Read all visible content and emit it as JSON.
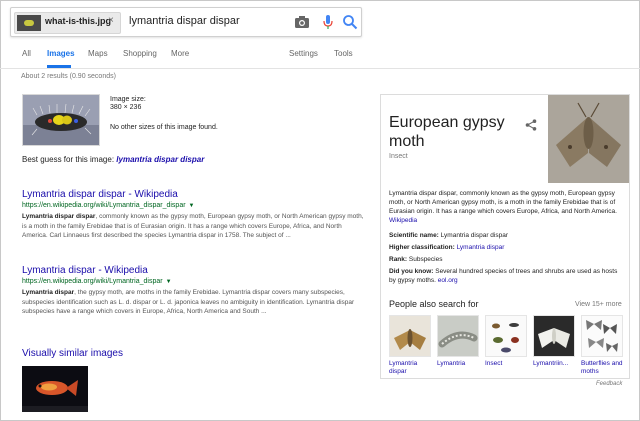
{
  "search": {
    "chip_label": "what-is-this.jpg",
    "chip_close": "×",
    "query": "lymantria dispar dispar"
  },
  "tabs": [
    {
      "label": "All"
    },
    {
      "label": "Images"
    },
    {
      "label": "Maps"
    },
    {
      "label": "Shopping"
    },
    {
      "label": "More"
    },
    {
      "label": "Settings"
    },
    {
      "label": "Tools"
    }
  ],
  "result_stats": "About 2 results (0.90 seconds)",
  "image_info": {
    "size_label": "Image size:",
    "size_value": "380 × 236",
    "no_other": "No other sizes of this image found."
  },
  "best_guess": {
    "prefix": "Best guess for this image:",
    "value": "lymantria dispar dispar"
  },
  "results": [
    {
      "title": "Lymantria dispar dispar - Wikipedia",
      "url": "https://en.wikipedia.org/wiki/Lymantria_dispar_dispar",
      "snippet_bold": "Lymantria dispar dispar",
      "snippet_rest": ", commonly known as the gypsy moth, European gypsy moth, or North American gypsy moth, is a moth in the family Erebidae that is of Eurasian origin. It has a range which covers Europe, Africa, and North America. Carl Linnaeus first described the species Lymantria dispar in 1758. The subject of ..."
    },
    {
      "title": "Lymantria dispar - Wikipedia",
      "url": "https://en.wikipedia.org/wiki/Lymantria_dispar",
      "snippet_bold": "Lymantria dispar",
      "snippet_rest": ", the gypsy moth, are moths in the family Erebidae. Lymantria dispar covers many subspecies, subspecies identification such as L. d. dispar or L. d. japonica leaves no ambiguity in identification. Lymantria dispar subspecies have a range which covers in Europe, Africa, North America and South ..."
    }
  ],
  "similar_title": "Visually similar images",
  "knowledge_panel": {
    "title": "European gypsy moth",
    "subtitle": "Insect",
    "description": "Lymantria dispar dispar, commonly known as the gypsy moth, European gypsy moth, or North American gypsy moth, is a moth in the family Erebidae that is of Eurasian origin. It has a range which covers Europe, Africa, and North America.",
    "description_link": "Wikipedia",
    "facts": [
      {
        "label": "Scientific name:",
        "value": "Lymantria dispar dispar",
        "link": ""
      },
      {
        "label": "Higher classification:",
        "value": "",
        "link": "Lymantria dispar"
      },
      {
        "label": "Rank:",
        "value": "Subspecies",
        "link": ""
      },
      {
        "label": "Did you know:",
        "value": "Several hundred species of trees and shrubs are used as hosts by gypsy moths.",
        "link": "eol.org"
      }
    ],
    "people_also_search": {
      "title": "People also search for",
      "more": "View 15+ more",
      "items": [
        {
          "label": "Lymantria dispar"
        },
        {
          "label": "Lymantria"
        },
        {
          "label": "Insect"
        },
        {
          "label": "Lymantriin..."
        },
        {
          "label": "Butterflies and moths"
        }
      ]
    }
  },
  "feedback": "Feedback"
}
